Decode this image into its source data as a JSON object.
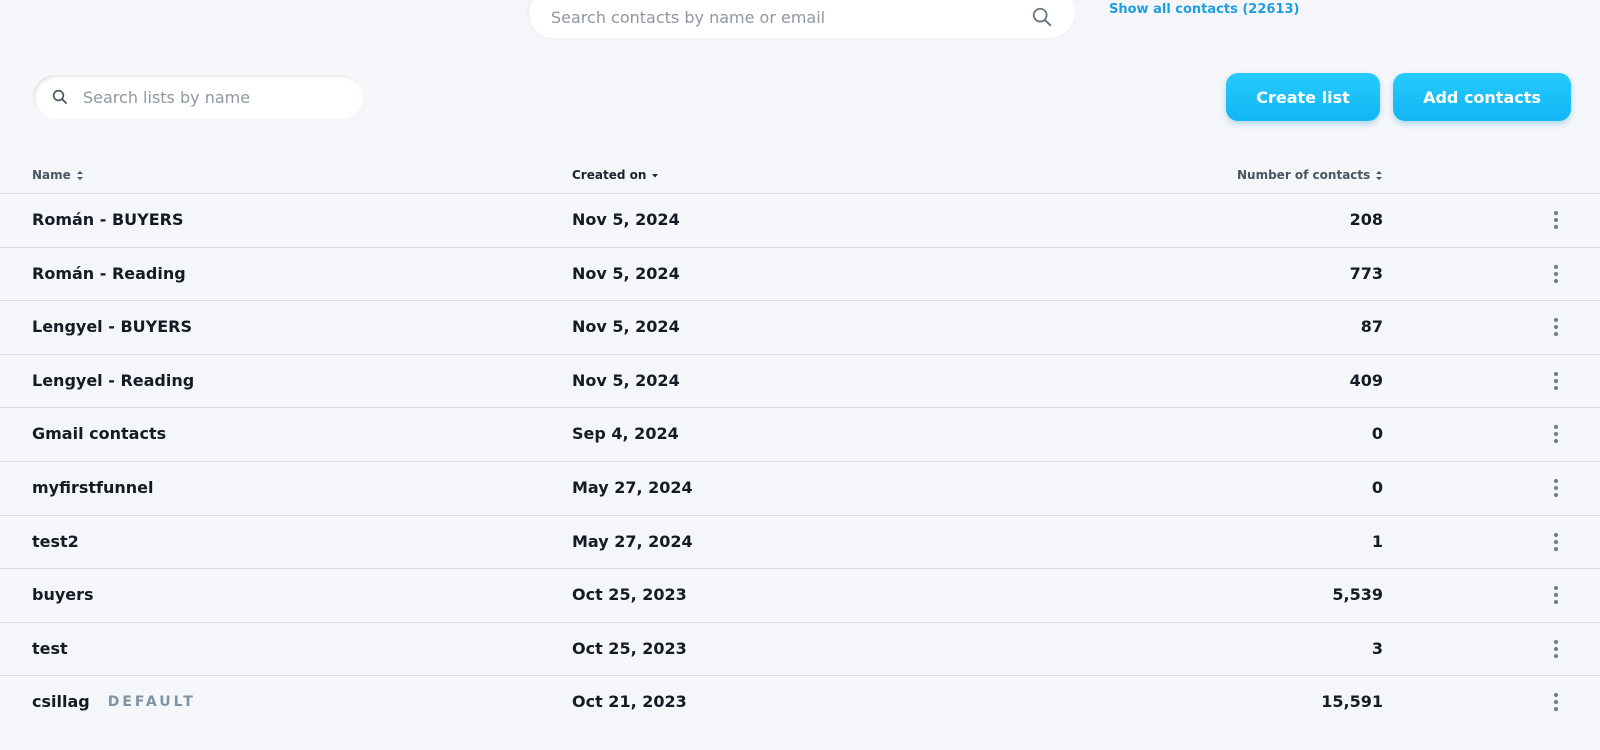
{
  "top_search": {
    "placeholder": "Search contacts by name or email",
    "icon": "search-icon"
  },
  "show_all_link": "Show all contacts (22613)",
  "list_search": {
    "placeholder": "Search lists by name",
    "icon": "search-icon"
  },
  "buttons": {
    "create_list": "Create list",
    "add_contacts": "Add contacts"
  },
  "colors": {
    "accent": "#1ec0fa",
    "link": "#1e9ee2",
    "background": "#f4f6f9",
    "badge": "#7e93a6"
  },
  "table": {
    "headers": {
      "name": "Name",
      "created_on": "Created on",
      "count": "Number of contacts"
    },
    "rows": [
      {
        "name": "Román - BUYERS",
        "badge": "",
        "created": "Nov 5, 2024",
        "count": "208"
      },
      {
        "name": "Román - Reading",
        "badge": "",
        "created": "Nov 5, 2024",
        "count": "773"
      },
      {
        "name": "Lengyel - BUYERS",
        "badge": "",
        "created": "Nov 5, 2024",
        "count": "87"
      },
      {
        "name": "Lengyel - Reading",
        "badge": "",
        "created": "Nov 5, 2024",
        "count": "409"
      },
      {
        "name": "Gmail contacts",
        "badge": "",
        "created": "Sep 4, 2024",
        "count": "0"
      },
      {
        "name": "myfirstfunnel",
        "badge": "",
        "created": "May 27, 2024",
        "count": "0"
      },
      {
        "name": "test2",
        "badge": "",
        "created": "May 27, 2024",
        "count": "1"
      },
      {
        "name": "buyers",
        "badge": "",
        "created": "Oct 25, 2023",
        "count": "5,539"
      },
      {
        "name": "test",
        "badge": "",
        "created": "Oct 25, 2023",
        "count": "3"
      },
      {
        "name": "csillag",
        "badge": "DEFAULT",
        "created": "Oct 21, 2023",
        "count": "15,591"
      }
    ]
  }
}
